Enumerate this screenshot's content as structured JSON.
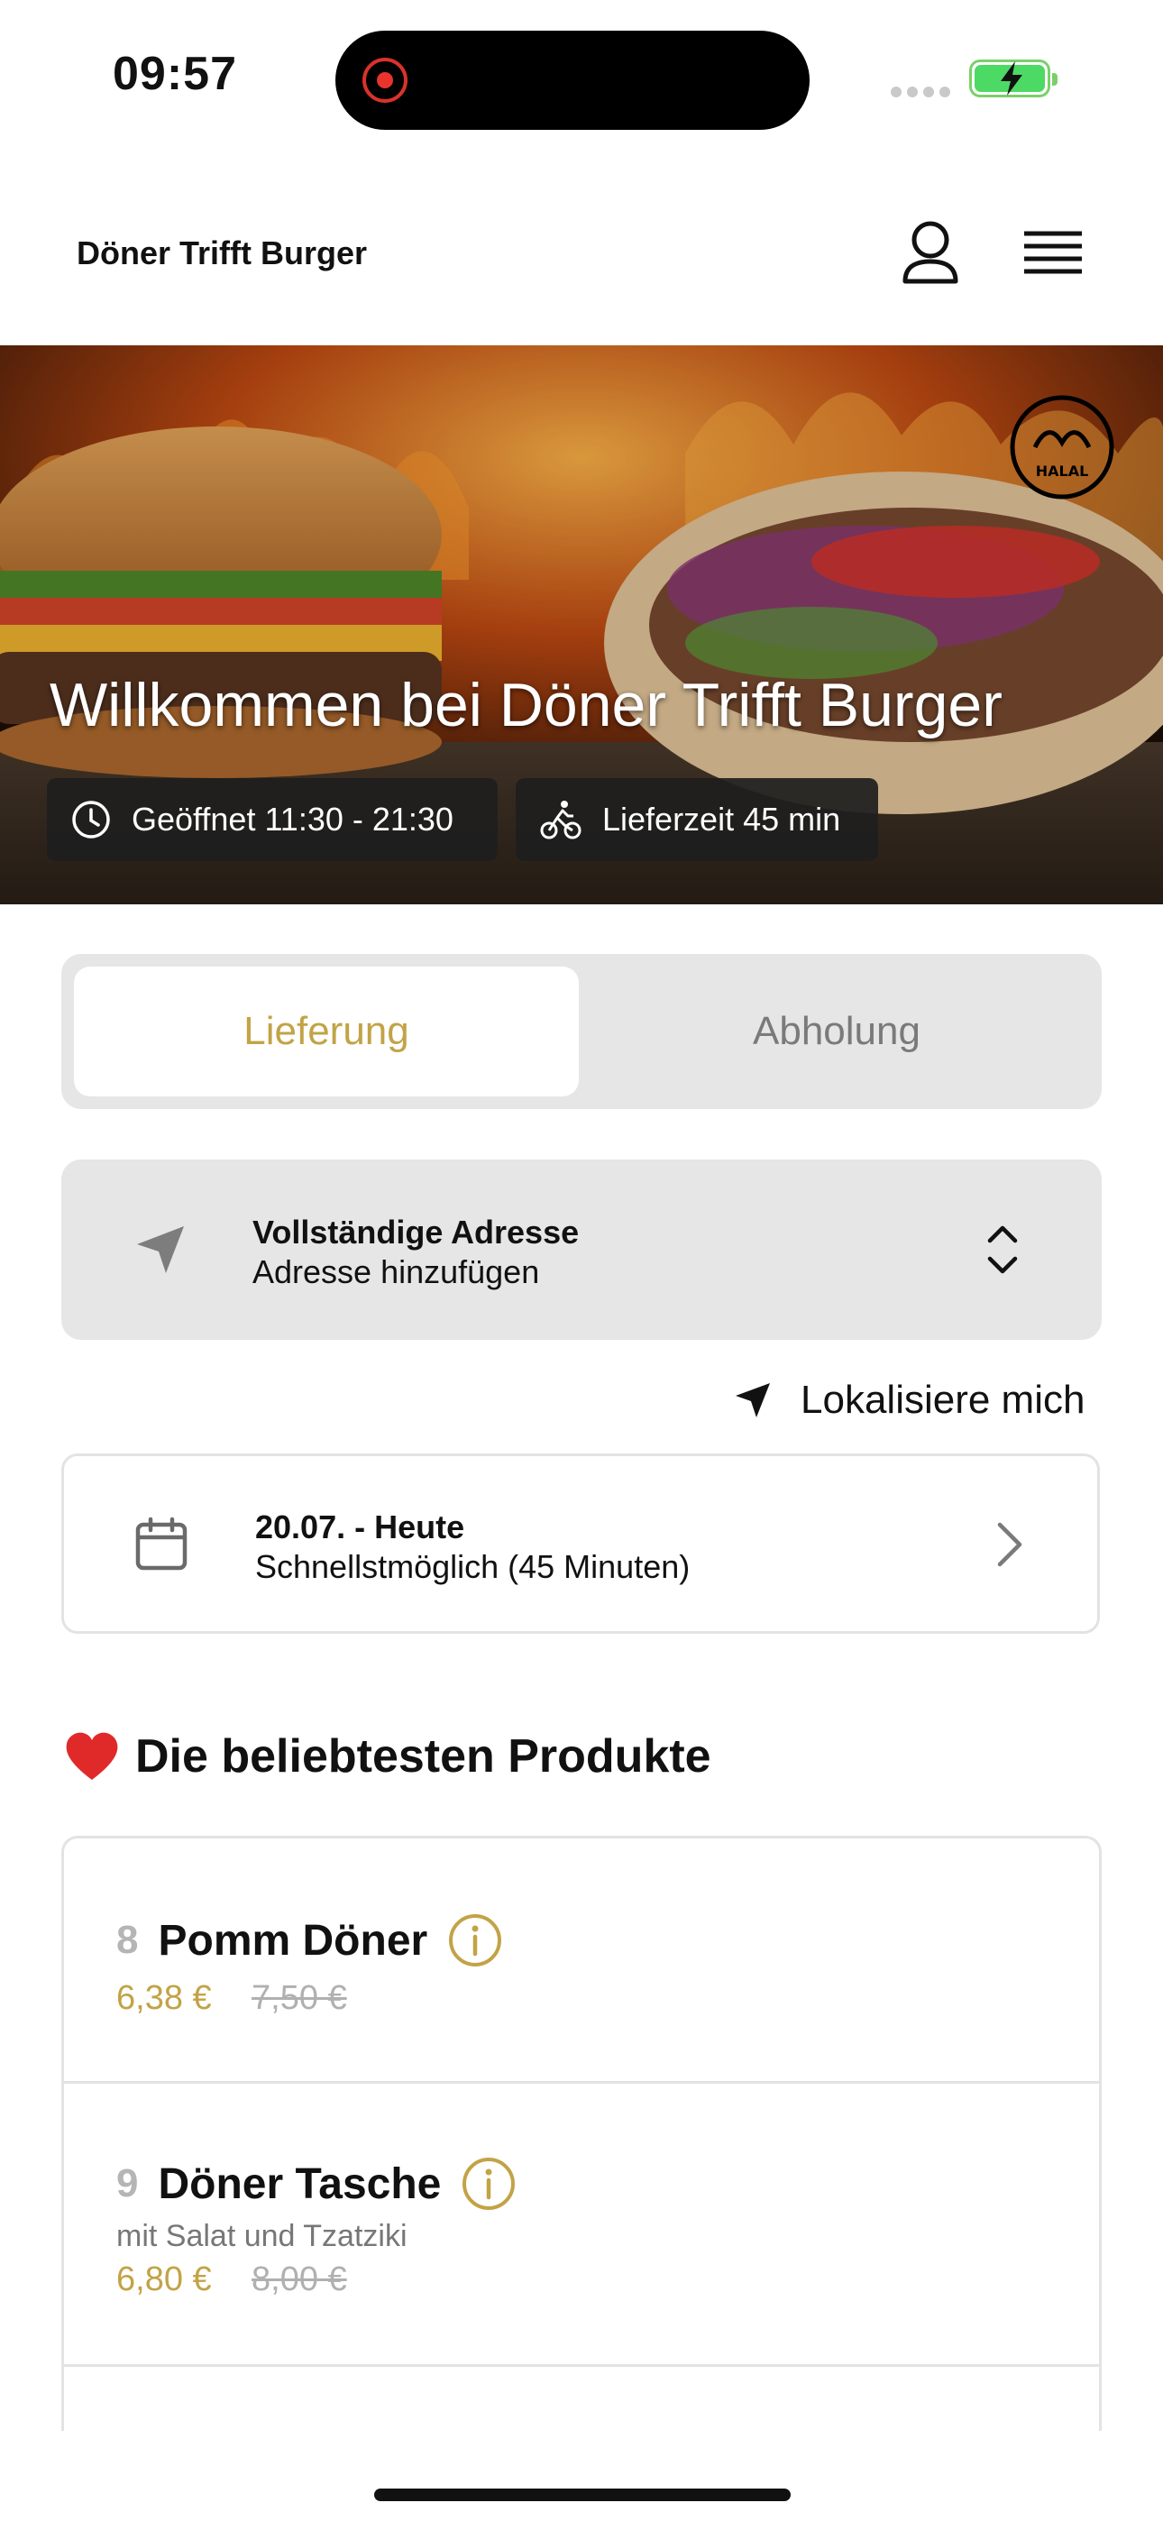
{
  "status_bar": {
    "time": "09:57"
  },
  "header": {
    "restaurant_name": "Döner Trifft Burger"
  },
  "hero": {
    "welcome": "Willkommen bei Döner Trifft Burger",
    "halal_label": "HALAL",
    "hours": "Geöffnet 11:30 - 21:30",
    "delivery_time": "Lieferzeit 45 min"
  },
  "order_mode": {
    "options": [
      "Lieferung",
      "Abholung"
    ],
    "selected": "Lieferung"
  },
  "address": {
    "title": "Vollständige Adresse",
    "subtitle": "Adresse hinzufügen",
    "locate_label": "Lokalisiere mich"
  },
  "schedule": {
    "date": "20.07. - Heute",
    "slot": "Schnellstmöglich (45 Minuten)"
  },
  "popular": {
    "title": "Die beliebtesten Produkte",
    "products": [
      {
        "number": "8",
        "name": "Pomm Döner",
        "description": "",
        "price": "6,38 €",
        "old_price": "7,50 €"
      },
      {
        "number": "9",
        "name": "Döner Tasche",
        "description": "mit Salat und Tzatziki",
        "price": "6,80 €",
        "old_price": "8,00 €"
      }
    ]
  },
  "colors": {
    "accent": "#c2a346",
    "panel": "#e6e6e6",
    "battery": "#4cd964",
    "record": "#e8342c"
  }
}
